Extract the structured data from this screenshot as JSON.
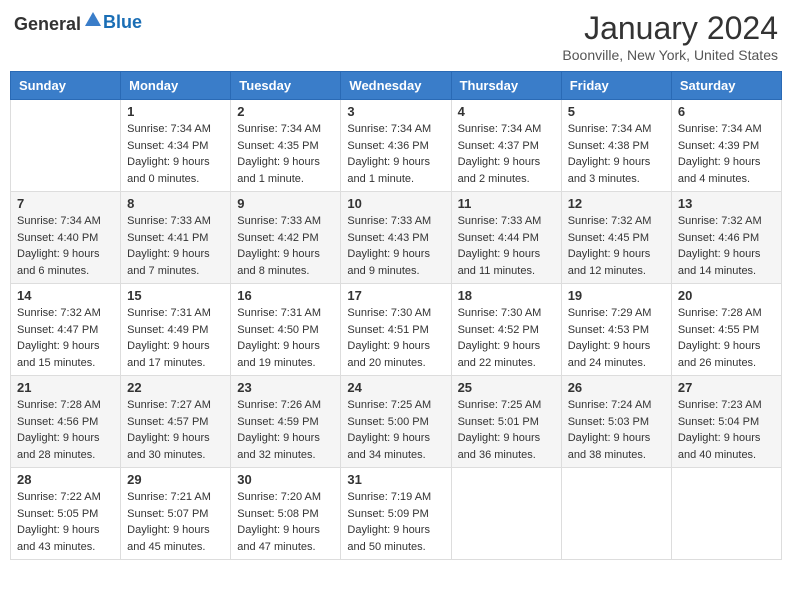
{
  "header": {
    "logo_general": "General",
    "logo_blue": "Blue",
    "title": "January 2024",
    "location": "Boonville, New York, United States"
  },
  "calendar": {
    "days_of_week": [
      "Sunday",
      "Monday",
      "Tuesday",
      "Wednesday",
      "Thursday",
      "Friday",
      "Saturday"
    ],
    "weeks": [
      [
        {
          "day": "",
          "sunrise": "",
          "sunset": "",
          "daylight": ""
        },
        {
          "day": "1",
          "sunrise": "Sunrise: 7:34 AM",
          "sunset": "Sunset: 4:34 PM",
          "daylight": "Daylight: 9 hours and 0 minutes."
        },
        {
          "day": "2",
          "sunrise": "Sunrise: 7:34 AM",
          "sunset": "Sunset: 4:35 PM",
          "daylight": "Daylight: 9 hours and 1 minute."
        },
        {
          "day": "3",
          "sunrise": "Sunrise: 7:34 AM",
          "sunset": "Sunset: 4:36 PM",
          "daylight": "Daylight: 9 hours and 1 minute."
        },
        {
          "day": "4",
          "sunrise": "Sunrise: 7:34 AM",
          "sunset": "Sunset: 4:37 PM",
          "daylight": "Daylight: 9 hours and 2 minutes."
        },
        {
          "day": "5",
          "sunrise": "Sunrise: 7:34 AM",
          "sunset": "Sunset: 4:38 PM",
          "daylight": "Daylight: 9 hours and 3 minutes."
        },
        {
          "day": "6",
          "sunrise": "Sunrise: 7:34 AM",
          "sunset": "Sunset: 4:39 PM",
          "daylight": "Daylight: 9 hours and 4 minutes."
        }
      ],
      [
        {
          "day": "7",
          "sunrise": "Sunrise: 7:34 AM",
          "sunset": "Sunset: 4:40 PM",
          "daylight": "Daylight: 9 hours and 6 minutes."
        },
        {
          "day": "8",
          "sunrise": "Sunrise: 7:33 AM",
          "sunset": "Sunset: 4:41 PM",
          "daylight": "Daylight: 9 hours and 7 minutes."
        },
        {
          "day": "9",
          "sunrise": "Sunrise: 7:33 AM",
          "sunset": "Sunset: 4:42 PM",
          "daylight": "Daylight: 9 hours and 8 minutes."
        },
        {
          "day": "10",
          "sunrise": "Sunrise: 7:33 AM",
          "sunset": "Sunset: 4:43 PM",
          "daylight": "Daylight: 9 hours and 9 minutes."
        },
        {
          "day": "11",
          "sunrise": "Sunrise: 7:33 AM",
          "sunset": "Sunset: 4:44 PM",
          "daylight": "Daylight: 9 hours and 11 minutes."
        },
        {
          "day": "12",
          "sunrise": "Sunrise: 7:32 AM",
          "sunset": "Sunset: 4:45 PM",
          "daylight": "Daylight: 9 hours and 12 minutes."
        },
        {
          "day": "13",
          "sunrise": "Sunrise: 7:32 AM",
          "sunset": "Sunset: 4:46 PM",
          "daylight": "Daylight: 9 hours and 14 minutes."
        }
      ],
      [
        {
          "day": "14",
          "sunrise": "Sunrise: 7:32 AM",
          "sunset": "Sunset: 4:47 PM",
          "daylight": "Daylight: 9 hours and 15 minutes."
        },
        {
          "day": "15",
          "sunrise": "Sunrise: 7:31 AM",
          "sunset": "Sunset: 4:49 PM",
          "daylight": "Daylight: 9 hours and 17 minutes."
        },
        {
          "day": "16",
          "sunrise": "Sunrise: 7:31 AM",
          "sunset": "Sunset: 4:50 PM",
          "daylight": "Daylight: 9 hours and 19 minutes."
        },
        {
          "day": "17",
          "sunrise": "Sunrise: 7:30 AM",
          "sunset": "Sunset: 4:51 PM",
          "daylight": "Daylight: 9 hours and 20 minutes."
        },
        {
          "day": "18",
          "sunrise": "Sunrise: 7:30 AM",
          "sunset": "Sunset: 4:52 PM",
          "daylight": "Daylight: 9 hours and 22 minutes."
        },
        {
          "day": "19",
          "sunrise": "Sunrise: 7:29 AM",
          "sunset": "Sunset: 4:53 PM",
          "daylight": "Daylight: 9 hours and 24 minutes."
        },
        {
          "day": "20",
          "sunrise": "Sunrise: 7:28 AM",
          "sunset": "Sunset: 4:55 PM",
          "daylight": "Daylight: 9 hours and 26 minutes."
        }
      ],
      [
        {
          "day": "21",
          "sunrise": "Sunrise: 7:28 AM",
          "sunset": "Sunset: 4:56 PM",
          "daylight": "Daylight: 9 hours and 28 minutes."
        },
        {
          "day": "22",
          "sunrise": "Sunrise: 7:27 AM",
          "sunset": "Sunset: 4:57 PM",
          "daylight": "Daylight: 9 hours and 30 minutes."
        },
        {
          "day": "23",
          "sunrise": "Sunrise: 7:26 AM",
          "sunset": "Sunset: 4:59 PM",
          "daylight": "Daylight: 9 hours and 32 minutes."
        },
        {
          "day": "24",
          "sunrise": "Sunrise: 7:25 AM",
          "sunset": "Sunset: 5:00 PM",
          "daylight": "Daylight: 9 hours and 34 minutes."
        },
        {
          "day": "25",
          "sunrise": "Sunrise: 7:25 AM",
          "sunset": "Sunset: 5:01 PM",
          "daylight": "Daylight: 9 hours and 36 minutes."
        },
        {
          "day": "26",
          "sunrise": "Sunrise: 7:24 AM",
          "sunset": "Sunset: 5:03 PM",
          "daylight": "Daylight: 9 hours and 38 minutes."
        },
        {
          "day": "27",
          "sunrise": "Sunrise: 7:23 AM",
          "sunset": "Sunset: 5:04 PM",
          "daylight": "Daylight: 9 hours and 40 minutes."
        }
      ],
      [
        {
          "day": "28",
          "sunrise": "Sunrise: 7:22 AM",
          "sunset": "Sunset: 5:05 PM",
          "daylight": "Daylight: 9 hours and 43 minutes."
        },
        {
          "day": "29",
          "sunrise": "Sunrise: 7:21 AM",
          "sunset": "Sunset: 5:07 PM",
          "daylight": "Daylight: 9 hours and 45 minutes."
        },
        {
          "day": "30",
          "sunrise": "Sunrise: 7:20 AM",
          "sunset": "Sunset: 5:08 PM",
          "daylight": "Daylight: 9 hours and 47 minutes."
        },
        {
          "day": "31",
          "sunrise": "Sunrise: 7:19 AM",
          "sunset": "Sunset: 5:09 PM",
          "daylight": "Daylight: 9 hours and 50 minutes."
        },
        {
          "day": "",
          "sunrise": "",
          "sunset": "",
          "daylight": ""
        },
        {
          "day": "",
          "sunrise": "",
          "sunset": "",
          "daylight": ""
        },
        {
          "day": "",
          "sunrise": "",
          "sunset": "",
          "daylight": ""
        }
      ]
    ]
  }
}
